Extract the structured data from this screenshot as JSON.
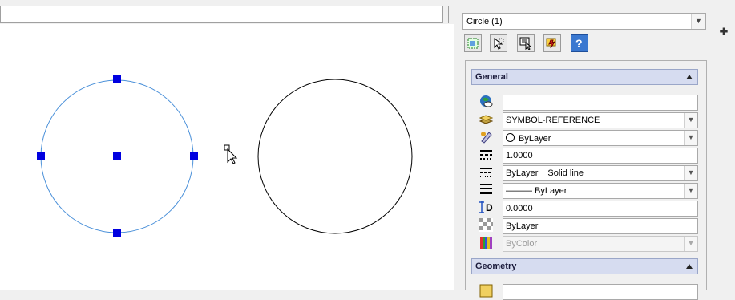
{
  "object_select": {
    "value": "Circle (1)"
  },
  "toolbar": {
    "buttons": [
      "select-objects-icon",
      "quick-select-icon",
      "pick-add-icon",
      "toggle-pickadd-icon",
      "help-icon"
    ],
    "help_label": "?"
  },
  "general": {
    "title": "General",
    "rows": [
      {
        "icon": "color-globe-icon",
        "value": ""
      },
      {
        "icon": "layer-icon",
        "value": "SYMBOL-REFERENCE"
      },
      {
        "icon": "color-icon",
        "value": "ByLayer"
      },
      {
        "icon": "linetype-scale-icon",
        "value": "1.0000"
      },
      {
        "icon": "linetype-icon",
        "value": "ByLayer",
        "value2": "Solid line"
      },
      {
        "icon": "lineweight-icon",
        "value": "——— ByLayer"
      },
      {
        "icon": "thickness-icon",
        "value": "0.0000",
        "icon_letter": "D"
      },
      {
        "icon": "transparency-icon",
        "value": "ByLayer"
      },
      {
        "icon": "plot-style-icon",
        "value": "ByColor"
      }
    ]
  },
  "geometry": {
    "title": "Geometry"
  },
  "colors": {
    "selected_circle": "#4a90d9",
    "grip": "#0000e0",
    "header_bg": "#d6dcf0"
  }
}
